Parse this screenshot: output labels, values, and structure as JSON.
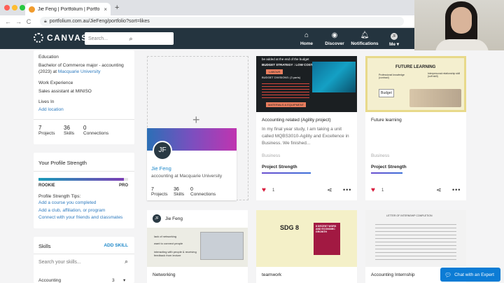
{
  "browser": {
    "tab_title": "Jie Feng | Portfolium | Portfo",
    "tab_close": "×",
    "new_tab": "+",
    "back": "←",
    "forward": "→",
    "reload": "C",
    "url": "portfolium.com.au/JieFeng/portfolio?sort=likes",
    "traffic_colors": [
      "#fe5f57",
      "#febc2e",
      "#28c840"
    ]
  },
  "header": {
    "logo": "CANVAS",
    "search_placeholder": "Search...",
    "nav": [
      {
        "label": "Home",
        "icon": "home-icon"
      },
      {
        "label": "Discover",
        "icon": "compass-icon"
      },
      {
        "label": "Notifications",
        "icon": "bell-icon"
      },
      {
        "label": "Me",
        "icon": "avatar-icon",
        "initials": "JF"
      }
    ]
  },
  "profile": {
    "education_label": "Education",
    "education_line1": "Bachelor of Commerce major - accounting",
    "education_line2_prefix": "(2023) at ",
    "education_school": "Macquarie University",
    "work_label": "Work Experience",
    "work_value": "Sales assistant at MINISO",
    "lives_label": "Lives In",
    "add_location": "Add location",
    "stats": [
      {
        "n": "7",
        "label": "Projects"
      },
      {
        "n": "36",
        "label": "Skills"
      },
      {
        "n": "0",
        "label": "Connections"
      }
    ]
  },
  "strength": {
    "title": "Your Profile Strength",
    "level_low": "ROOKIE",
    "level_high": "PRO",
    "fill": 0.95,
    "tips_label": "Profile Strength Tips:",
    "tips": [
      "Add a course you completed",
      "Add a club, affiliation, or program",
      "Connect with your friends and classmates"
    ]
  },
  "skills": {
    "title": "Skills",
    "add_label": "ADD SKILL",
    "search_placeholder": "Search your skills...",
    "first_item": "Accounting",
    "first_count": "3"
  },
  "profile_card": {
    "plus": "+",
    "initials": "JF",
    "name": "Jie Feng",
    "subtitle": "accounting at Macquarie University",
    "stats": [
      {
        "n": "7",
        "label": "Projects"
      },
      {
        "n": "36",
        "label": "Skills"
      },
      {
        "n": "0",
        "label": "Connections"
      }
    ]
  },
  "projects": [
    {
      "title": "Accounting related (Agility project)",
      "desc": "In my final year study, I am taking a unit called MQBS3010-Agility and Excellence in Business. We finished...",
      "tag": "Business",
      "strength_label": "Project Strength",
      "strength": 0.55,
      "likes": "1",
      "thumb_text": [
        "be added at the end of the budget",
        "BUDGET STRATEGY : LOW COST",
        "LABOUR",
        "BUDGET DIVISIONS: (3 parts)",
        "MATERIALS & EQUIPMENT"
      ]
    },
    {
      "title": "Future learning",
      "desc": "",
      "tag": "Business",
      "strength_label": "Project Strength",
      "strength": 0.35,
      "likes": "1",
      "thumb_text": [
        "FUTURE LEARNING",
        "Professional knowledge (contract)",
        "Interpersonal relationship skill (soft skill)",
        "Budget"
      ]
    }
  ],
  "bottom_cards": [
    {
      "title": "Networking",
      "author_initials": "JF",
      "author": "Jie Feng",
      "thumb_text": [
        "lack of networking",
        "want to connect people",
        "interacting with people & receiving feedback from lecture"
      ]
    },
    {
      "title": "teamwork",
      "thumb_text": [
        "SDG 8",
        "8 DECENT WORK AND ECONOMIC GROWTH"
      ]
    },
    {
      "title": "Accounting Internship",
      "thumb_text": [
        "LETTER OF INTERNSHIP COMPLETION"
      ]
    }
  ],
  "chat": {
    "label": "Chat with an Expert"
  }
}
